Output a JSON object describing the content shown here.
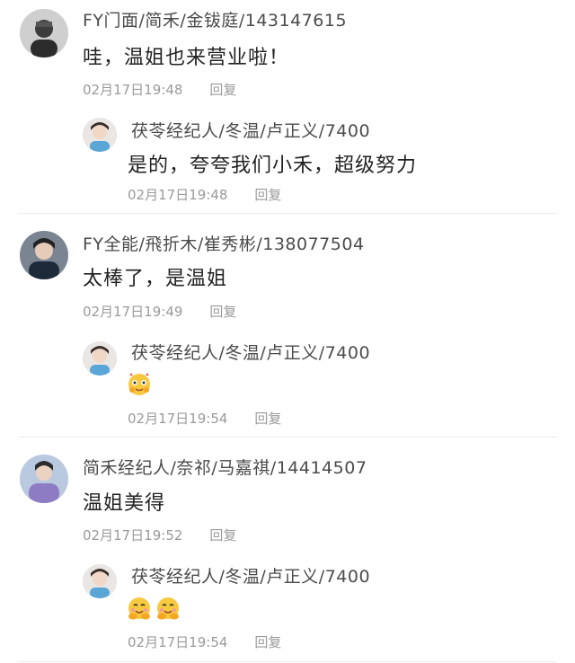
{
  "comments": [
    {
      "author": "FY门面/简禾/金钹庭/143147615",
      "text": "哇，温姐也来营业啦！",
      "time": "02月17日19:48",
      "reply_label": "回复",
      "avatar_icon": "user-avatar-icon",
      "reply": {
        "author": "茯苓经纪人/冬温/卢正义/7400",
        "text": "是的，夸夸我们小禾，超级努力",
        "time": "02月17日19:48",
        "reply_label": "回复",
        "avatar_icon": "user-avatar-icon"
      }
    },
    {
      "author": "FY全能/飛折木/崔秀彬/138077504",
      "text": "太棒了，是温姐",
      "time": "02月17日19:49",
      "reply_label": "回复",
      "avatar_icon": "user-avatar-icon",
      "reply": {
        "author": "茯苓经纪人/冬温/卢正义/7400",
        "text": "",
        "emojis": [
          "blush-hands-emoji"
        ],
        "time": "02月17日19:54",
        "reply_label": "回复",
        "avatar_icon": "user-avatar-icon"
      }
    },
    {
      "author": "简禾经纪人/奈祁/马嘉祺/14414507",
      "text": "温姐美得",
      "time": "02月17日19:52",
      "reply_label": "回复",
      "avatar_icon": "user-avatar-icon",
      "reply": {
        "author": "茯苓经纪人/冬温/卢正义/7400",
        "text": "",
        "emojis": [
          "hug-emoji",
          "hug-emoji"
        ],
        "time": "02月17日19:54",
        "reply_label": "回复",
        "avatar_icon": "user-avatar-icon"
      }
    }
  ],
  "colors": {
    "meta_gray": "#9a9a9a",
    "divider": "#ececec",
    "emoji_yellow": "#f7c93e"
  }
}
